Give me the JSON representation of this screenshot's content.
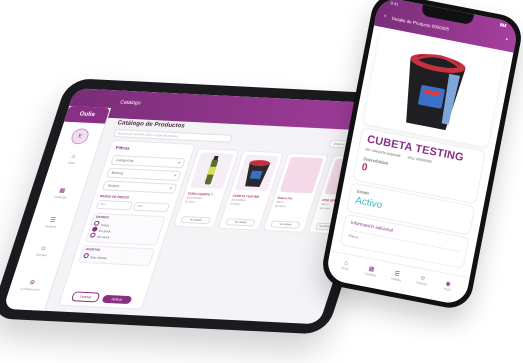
{
  "tablet": {
    "app_brand": "Oulis",
    "top_title": "Catalogo",
    "avatar_initial": "E",
    "nav": [
      {
        "label": "Inicio",
        "icon": "home-icon"
      },
      {
        "label": "Catálogo",
        "icon": "catalog-icon"
      },
      {
        "label": "Pedidos",
        "icon": "orders-icon"
      },
      {
        "label": "Clientes",
        "icon": "clients-icon"
      },
      {
        "label": "Configuración",
        "icon": "settings-icon"
      }
    ],
    "heading": "Catálogo de Productos",
    "search_placeholder": "Buscar por nombre, SKU o especificaciones",
    "sort_label": "Ordenar por nombre",
    "filters": {
      "title": "Filtros",
      "categories": "Categorías",
      "brands": "Marcas",
      "groups": "Grupos",
      "price_label": "RANGO DE PRECIO",
      "price_min": "Mín",
      "price_max": "Máx",
      "status_label": "ESTADO",
      "status_options": [
        "Todos",
        "En stock",
        "Sin stock"
      ],
      "status_selected": 1,
      "other_label": "OFERTAS",
      "other_option": "Solo ofertas",
      "clear": "Limpiar",
      "apply": "Aplicar"
    },
    "products": [
      {
        "name": "CUBA LIQUIDO T",
        "sku": "SKU 0000001",
        "stock": "En stock",
        "button": "Ver detalle"
      },
      {
        "name": "CUBETA TESTING",
        "sku": "SKU 000005",
        "stock": "En stock",
        "button": "Ver detalle"
      },
      {
        "name": "Nuevo Art",
        "sku": "SKU 0",
        "stock": "Sin stock",
        "button": "Ver detalle"
      },
      {
        "name": "POO SPRAY T",
        "sku": "SKU 0",
        "stock": "Sin stock",
        "button": "Ver detalle"
      }
    ]
  },
  "phone": {
    "time": "9:41",
    "status": "▮▮▮",
    "title": "Detalle de Producto 0000005",
    "product_title": "CUBETA TESTING",
    "category": "Sin categoría asignada",
    "sku": "SKU: 00000005",
    "availability_label": "Disponibilidad",
    "availability_value": "0",
    "state_label": "Estado",
    "state_value": "Activo",
    "extra_label": "Información adicional",
    "extra_sub": "Marca",
    "tabs": [
      {
        "label": "Inicio",
        "icon": "home-icon"
      },
      {
        "label": "Catálogo",
        "icon": "catalog-icon"
      },
      {
        "label": "Pedidos",
        "icon": "orders-icon"
      },
      {
        "label": "Clientes",
        "icon": "clients-icon"
      },
      {
        "label": "Perfil",
        "icon": "profile-icon"
      }
    ]
  },
  "colors": {
    "brand": "#8a2f86",
    "accent_pink": "#b2306b",
    "active_teal": "#39b8c8"
  }
}
